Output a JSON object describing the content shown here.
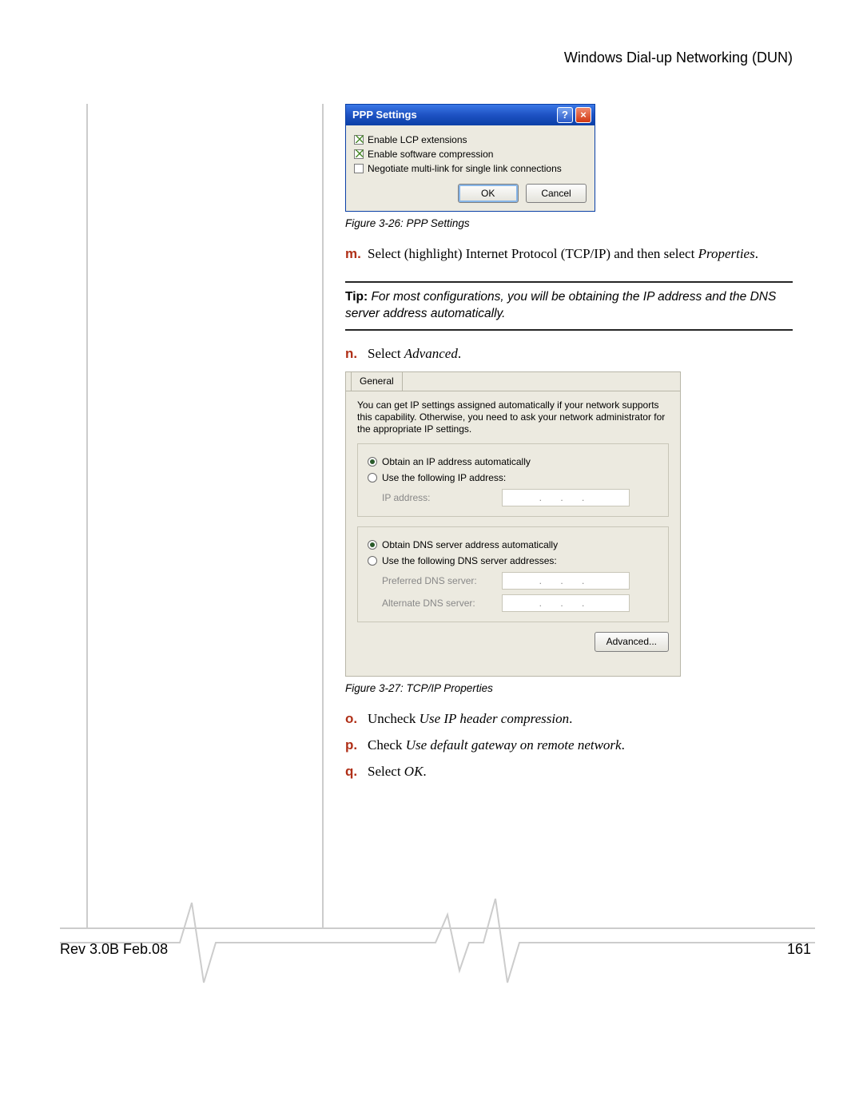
{
  "header": {
    "title": "Windows Dial-up Networking (DUN)"
  },
  "footer": {
    "rev": "Rev 3.0B Feb.08",
    "page": "161"
  },
  "ppp_dialog": {
    "title": "PPP Settings",
    "options": {
      "lcp": {
        "label": "Enable LCP extensions",
        "checked": true
      },
      "swcomp": {
        "label": "Enable software compression",
        "checked": true
      },
      "multilink": {
        "label": "Negotiate multi-link for single link connections",
        "checked": false
      }
    },
    "ok": "OK",
    "cancel": "Cancel"
  },
  "fig26": "Figure 3-26: PPP Settings",
  "steps": {
    "m": {
      "label": "m.",
      "text_a": "Select (highlight) Internet Protocol (TCP/IP) and then select ",
      "text_b": "Properties",
      "text_c": "."
    },
    "n": {
      "label": "n.",
      "text_a": "Select ",
      "text_b": "Advanced",
      "text_c": "."
    },
    "o": {
      "label": "o.",
      "text_a": "Uncheck ",
      "text_b": "Use IP header compression",
      "text_c": "."
    },
    "p": {
      "label": "p.",
      "text_a": "Check ",
      "text_b": "Use default gateway on remote network",
      "text_c": "."
    },
    "q": {
      "label": "q.",
      "text_a": "Select ",
      "text_b": "OK",
      "text_c": "."
    }
  },
  "tip": {
    "lead": "Tip: ",
    "body": "For most configurations, you will be obtaining the IP address and the DNS server address automatically."
  },
  "tcpip_dialog": {
    "tab": "General",
    "intro": "You can get IP settings assigned automatically if your network supports this capability. Otherwise, you need to ask your network administrator for the appropriate IP settings.",
    "ip_auto": "Obtain an IP address automatically",
    "ip_manual": "Use the following IP address:",
    "ip_label": "IP address:",
    "dns_auto": "Obtain DNS server address automatically",
    "dns_manual": "Use the following DNS server addresses:",
    "dns_pref": "Preferred DNS server:",
    "dns_alt": "Alternate DNS server:",
    "advanced": "Advanced..."
  },
  "fig27": "Figure 3-27: TCP/IP Properties"
}
